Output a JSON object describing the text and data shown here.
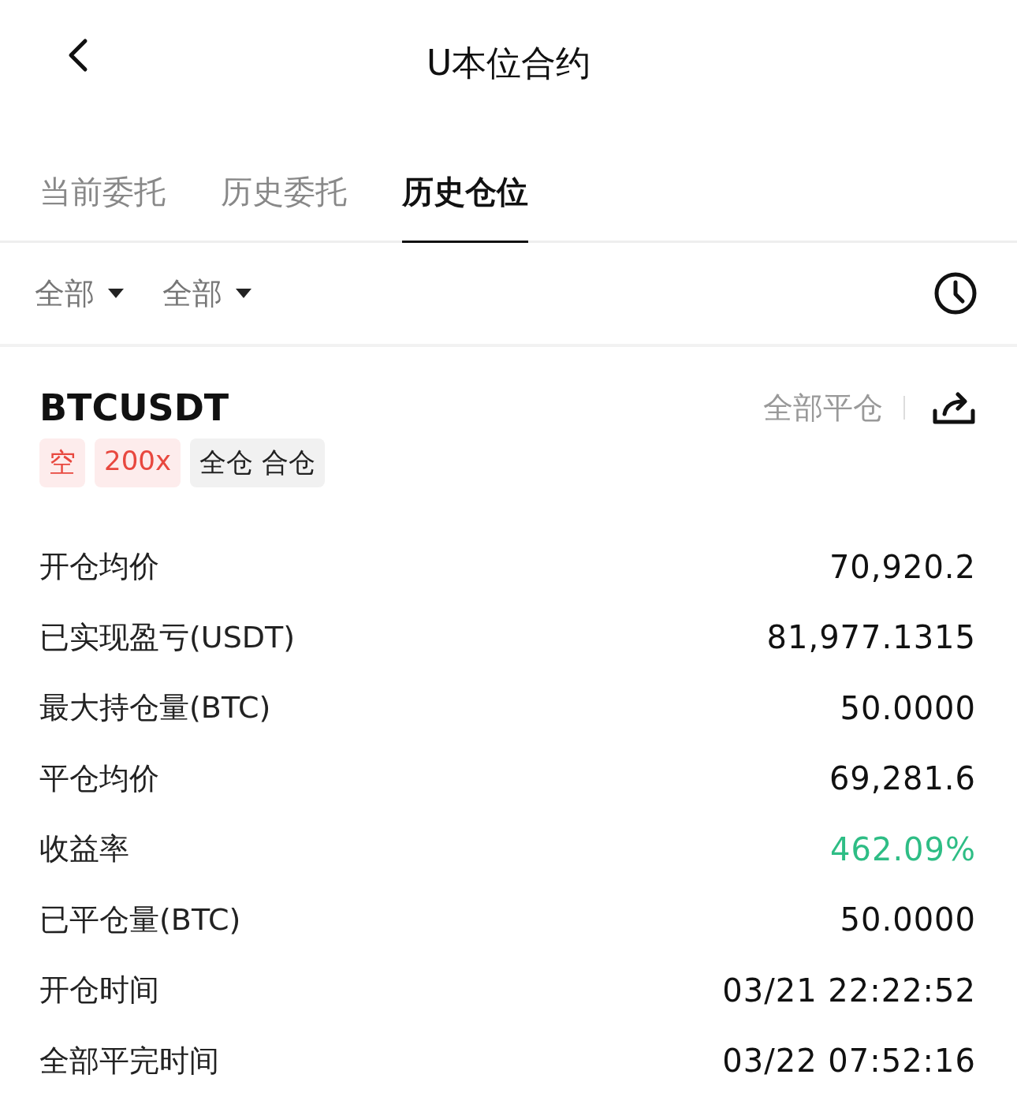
{
  "header": {
    "title": "U本位合约"
  },
  "tabs": [
    {
      "label": "当前委托",
      "selected": false
    },
    {
      "label": "历史委托",
      "selected": false
    },
    {
      "label": "历史仓位",
      "selected": true
    }
  ],
  "filters": [
    {
      "label": "全部"
    },
    {
      "label": "全部"
    }
  ],
  "position": {
    "symbol": "BTCUSDT",
    "close_all": "全部平仓",
    "tags": [
      {
        "label": "空",
        "kind": "side"
      },
      {
        "label": "200x",
        "kind": "leverage"
      },
      {
        "label": "全仓 合仓",
        "kind": "mode"
      }
    ],
    "rows": [
      {
        "label": "开仓均价",
        "value": "70,920.2",
        "kind": "plain"
      },
      {
        "label": "已实现盈亏(USDT)",
        "value": "81,977.1315",
        "kind": "plain"
      },
      {
        "label": "最大持仓量(BTC)",
        "value": "50.0000",
        "kind": "plain"
      },
      {
        "label": "平仓均价",
        "value": "69,281.6",
        "kind": "plain"
      },
      {
        "label": "收益率",
        "value": "462.09%",
        "kind": "gain"
      },
      {
        "label": "已平仓量(BTC)",
        "value": "50.0000",
        "kind": "plain"
      },
      {
        "label": "开仓时间",
        "value": "03/21 22:22:52",
        "kind": "plain"
      },
      {
        "label": "全部平完时间",
        "value": "03/22 07:52:16",
        "kind": "plain"
      }
    ]
  }
}
